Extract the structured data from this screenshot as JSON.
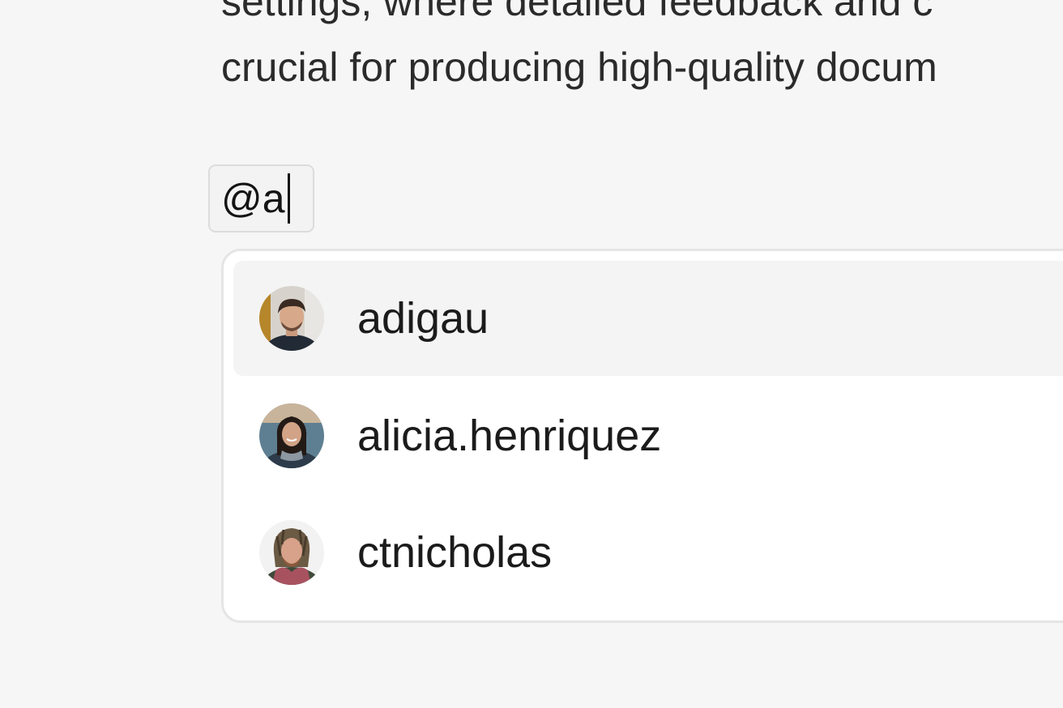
{
  "document": {
    "line1": "settings, where detailed feedback and c",
    "line2": "crucial for producing high-quality docum"
  },
  "mention_input": {
    "value": "@a"
  },
  "suggestions": [
    {
      "username": "adigau",
      "avatar_icon": "user-avatar-icon",
      "highlighted": true
    },
    {
      "username": "alicia.henriquez",
      "avatar_icon": "user-avatar-icon",
      "highlighted": false
    },
    {
      "username": "ctnicholas",
      "avatar_icon": "user-avatar-icon",
      "highlighted": false
    }
  ]
}
